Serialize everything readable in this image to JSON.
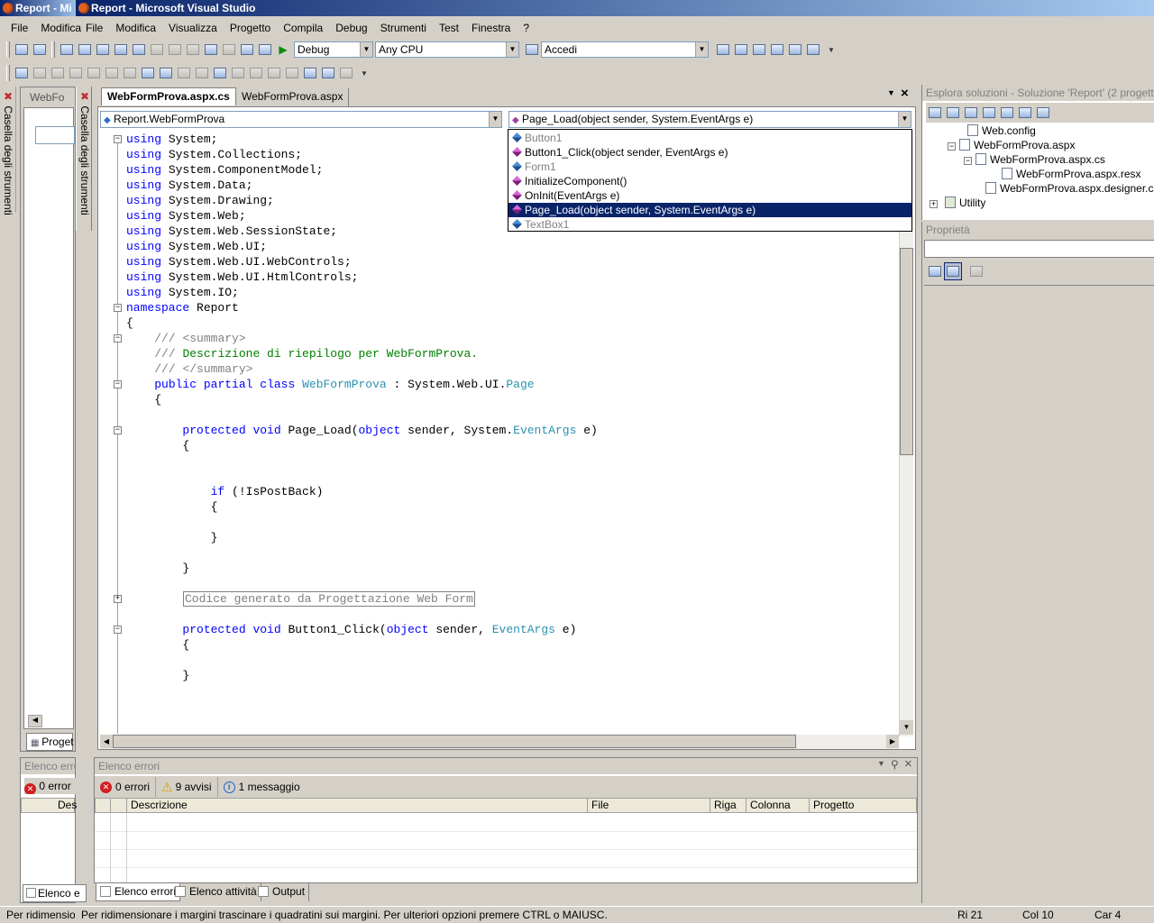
{
  "back_window": {
    "title": "Report - Mi"
  },
  "window": {
    "title": "Report - Microsoft Visual Studio"
  },
  "back_menu": {
    "items": [
      "File",
      "Modifica"
    ]
  },
  "menu": {
    "items": [
      "File",
      "Modifica",
      "Visualizza",
      "Progetto",
      "Compila",
      "Debug",
      "Strumenti",
      "Test",
      "Finestra",
      "?"
    ]
  },
  "toolbar": {
    "config": "Debug",
    "platform": "Any CPU",
    "find": "Accedi"
  },
  "side_tabs": {
    "toolbox": "Casella degli strumenti",
    "back_toolbox": "Casella degli strumenti"
  },
  "back_doc": {
    "tab": "WebFo",
    "bottom_tab": "Proget"
  },
  "editor": {
    "tabs": [
      "WebFormProva.aspx.cs",
      "WebFormProva.aspx"
    ],
    "class_combo": "Report.WebFormProva",
    "member_combo": "Page_Load(object sender, System.EventArgs e)",
    "members": [
      {
        "label": "Button1",
        "kind": "field",
        "state": "gray"
      },
      {
        "label": "Button1_Click(object sender, EventArgs e)",
        "kind": "method",
        "state": "normal"
      },
      {
        "label": "Form1",
        "kind": "field",
        "state": "gray"
      },
      {
        "label": "InitializeComponent()",
        "kind": "method",
        "state": "normal"
      },
      {
        "label": "OnInit(EventArgs e)",
        "kind": "method",
        "state": "normal"
      },
      {
        "label": "Page_Load(object sender, System.EventArgs e)",
        "kind": "method",
        "state": "selected"
      },
      {
        "label": "TextBox1",
        "kind": "field",
        "state": "gray"
      }
    ],
    "code": {
      "kw_using": "using",
      "kw_namespace": "namespace",
      "kw_public": "public",
      "kw_partial": "partial",
      "kw_class": "class",
      "kw_protected": "protected",
      "kw_void": "void",
      "kw_object": "object",
      "kw_if": "if",
      "usings": [
        "System;",
        "System.Collections;",
        "System.ComponentModel;",
        "System.Data;",
        "System.Drawing;",
        "System.Web;",
        "System.Web.SessionState;",
        "System.Web.UI;",
        "System.Web.UI.WebControls;",
        "System.Web.UI.HtmlControls;",
        "System.IO;"
      ],
      "ns_name": "Report",
      "open_brace": "{",
      "close_brace": "}",
      "doc_prefix": "///",
      "summary_open": "<summary>",
      "summary_text": "Descrizione di riepilogo per WebFormProva.",
      "summary_close": "</summary>",
      "class_name": "WebFormProva",
      "class_colon": ":",
      "base_ns": "System.Web.UI.",
      "base_type": "Page",
      "page_load_name": "Page_Load(",
      "page_load_params_a": "sender, System.",
      "type_eventargs": "EventArgs",
      "param_e_close": "e)",
      "if_cond": "(!IsPostBack)",
      "region_label": "Codice generato da Progettazione Web Form",
      "button_click_name": "Button1_Click(",
      "button_click_params": "sender,"
    }
  },
  "solution_explorer": {
    "title": "Esplora soluzioni - Soluzione 'Report' (2 progetti)",
    "items": [
      "Web.config",
      "WebFormProva.aspx",
      "WebFormProva.aspx.cs",
      "WebFormProva.aspx.resx",
      "WebFormProva.aspx.designer.cs",
      "Utility"
    ]
  },
  "properties": {
    "title": "Proprietà"
  },
  "error_list": {
    "title": "Elenco errori",
    "errors": "0 errori",
    "warnings": "9 avvisi",
    "messages": "1 messaggio",
    "columns": [
      "Descrizione",
      "File",
      "Riga",
      "Colonna",
      "Progetto"
    ]
  },
  "back_error_list": {
    "title": "Elenco errori",
    "errors": "0 error",
    "col": "Des",
    "tab": "Elenco e"
  },
  "bottom_tabs": [
    "Elenco errori",
    "Elenco attività",
    "Output"
  ],
  "status": {
    "back_text": "Per ridimension",
    "text": "Per ridimensionare i margini trascinare i quadratini sui margini. Per ulteriori opzioni premere CTRL o MAIUSC.",
    "line": "Ri 21",
    "col": "Col 10",
    "char": "Car 4"
  }
}
